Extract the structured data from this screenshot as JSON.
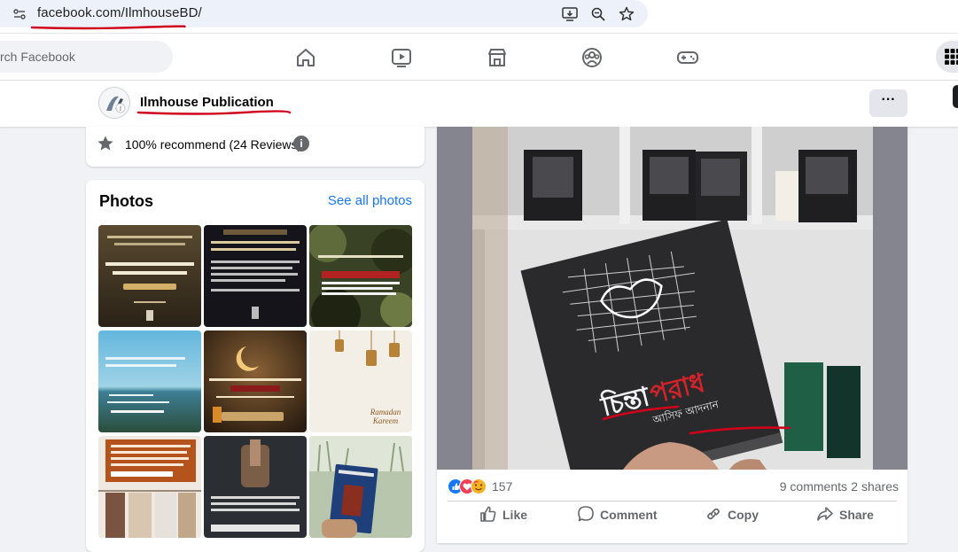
{
  "browser": {
    "url": "facebook.com/IlmhouseBD/",
    "icons": [
      "site-info-icon",
      "install-app-icon",
      "zoom-icon",
      "bookmark-star-icon"
    ],
    "annotation_color": "#d0021b"
  },
  "nav": {
    "search_placeholder": "rch Facebook",
    "tabs": [
      "home-icon",
      "watch-icon",
      "marketplace-icon",
      "groups-icon",
      "gaming-icon"
    ],
    "menu_icon": "grid-menu-icon",
    "accent_color": "#1877f2"
  },
  "page": {
    "name": "Ilmhouse Publication",
    "more_label": "···"
  },
  "recommend": {
    "text": "100% recommend (24 Reviews)",
    "info_label": "i"
  },
  "photos": {
    "title": "Photos",
    "see_all": "See all photos",
    "thumbs": [
      {
        "brand": "#3b2e1c",
        "text": "কাফের মুসলিম"
      },
      {
        "brand": "#1b1a22",
        "text": "আয়াত"
      },
      {
        "brand": "#2e3320",
        "text": "বিজ্ঞাপন"
      },
      {
        "brand": "#3d8fb8",
        "text": "আয়াত"
      },
      {
        "brand": "#4a3520",
        "text": "রমজান"
      },
      {
        "brand": "#f1ebe0",
        "text": "Ramadan Kareem"
      },
      {
        "brand": "#b24a16",
        "text": "নোটিশ"
      },
      {
        "brand": "#23262c",
        "text": "হাদিস"
      },
      {
        "brand": "#c9d4c2",
        "text": "চিন্তাপরাধ"
      }
    ]
  },
  "post": {
    "book_title": "চিন্তাপরাধ",
    "book_author": "আসিফ আদনান",
    "reaction_count": "157",
    "comments": "9 comments",
    "shares": "2 shares",
    "actions": {
      "like": "Like",
      "comment": "Comment",
      "copy": "Copy",
      "share": "Share"
    }
  }
}
